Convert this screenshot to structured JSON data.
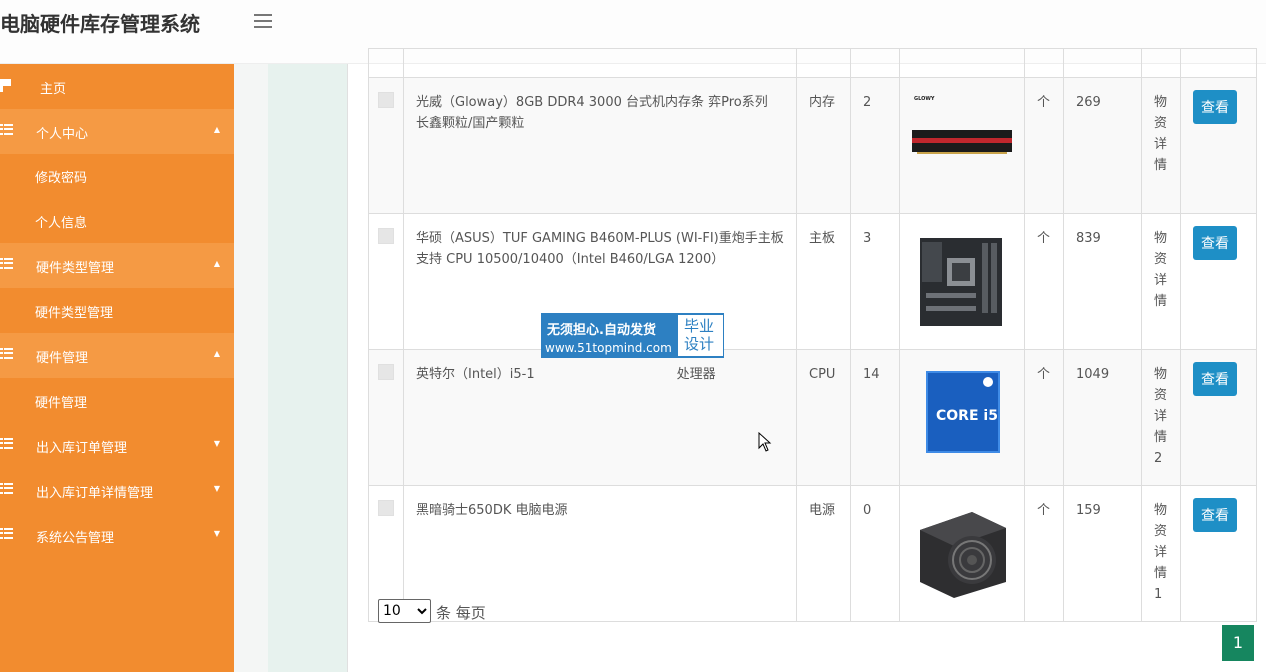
{
  "header": {
    "title": "电脑硬件库存管理系统",
    "menu_icon": "hamburger-icon"
  },
  "sidebar": {
    "items": [
      {
        "label": "主页",
        "icon": "flag-icon"
      },
      {
        "label": "个人中心",
        "icon": "grid-icon",
        "arrow": "▲"
      },
      {
        "label": "修改密码"
      },
      {
        "label": "个人信息"
      },
      {
        "label": "硬件类型管理",
        "icon": "grid-icon",
        "arrow": "▲"
      },
      {
        "label": "硬件类型管理"
      },
      {
        "label": "硬件管理",
        "icon": "grid-icon",
        "arrow": "▲"
      },
      {
        "label": "硬件管理"
      },
      {
        "label": "出入库订单管理",
        "icon": "grid-icon",
        "arrow": "▼"
      },
      {
        "label": "出入库订单详情管理",
        "icon": "grid-icon",
        "arrow": "▼"
      },
      {
        "label": "系统公告管理",
        "icon": "grid-icon",
        "arrow": "▼"
      }
    ]
  },
  "table": {
    "rows": [
      {
        "name": "光威（Gloway）8GB DDR4 3000 台式机内存条 弈Pro系列 长鑫颗粒/国产颗粒",
        "type": "内存",
        "qty": "2",
        "image": "ram-stick-image",
        "unit": "个",
        "price": "269",
        "detail": "物资详情",
        "action": "查看"
      },
      {
        "name": "华硕（ASUS）TUF GAMING B460M-PLUS (WI-FI)重炮手主板 支持 CPU 10500/10400（Intel B460/LGA 1200）",
        "type": "主板",
        "qty": "3",
        "image": "motherboard-image",
        "unit": "个",
        "price": "839",
        "detail": "物资详情",
        "action": "查看"
      },
      {
        "name": "英特尔（Intel）i5-1",
        "name_tail": "处理器",
        "type": "CPU",
        "qty": "14",
        "image": "cpu-box-image",
        "image_text": "CORE i5",
        "unit": "个",
        "price": "1049",
        "detail": "物资详情2",
        "action": "查看"
      },
      {
        "name": "黑暗骑士650DK 电脑电源",
        "type": "电源",
        "qty": "0",
        "image": "power-supply-image",
        "unit": "个",
        "price": "159",
        "detail": "物资详情1",
        "action": "查看"
      }
    ]
  },
  "pagination": {
    "page_size": "10",
    "page_size_options": [
      "10"
    ],
    "page_size_label": "条 每页",
    "current_page": "1"
  },
  "watermark": {
    "line1": "无须担心.自动发货",
    "line2": "www.51topmind.com",
    "right_line1": "毕业",
    "right_line2": "设计"
  },
  "colors": {
    "sidebar": "#f28c2f",
    "sidebar_group": "#f59a44",
    "button": "#1e8fc6",
    "page_active": "#16865f",
    "watermark": "#2d80c2"
  }
}
